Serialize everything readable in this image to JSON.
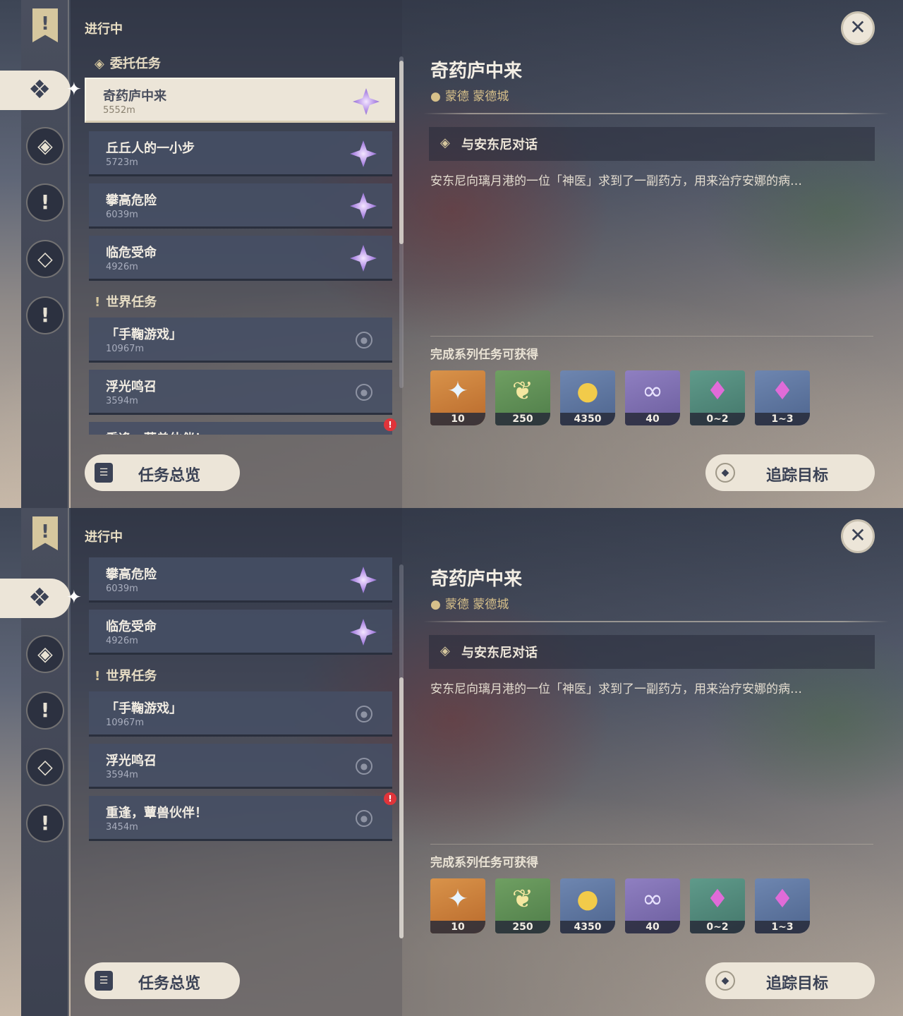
{
  "screens": [
    {
      "section_header": "进行中",
      "categories": [
        {
          "label": "委托任务"
        },
        {
          "label": "世界任务"
        }
      ],
      "quests": [
        {
          "name": "奇药庐中来",
          "distance": "5552m"
        },
        {
          "name": "丘丘人的一小步",
          "distance": "5723m"
        },
        {
          "name": "攀高危险",
          "distance": "6039m"
        },
        {
          "name": "临危受命",
          "distance": "4926m"
        },
        {
          "name": "「手鞠游戏」",
          "distance": "10967m"
        },
        {
          "name": "浮光鸣召",
          "distance": "3594m"
        },
        {
          "name": "重逢，蕈兽伙伴！",
          "distance": ""
        }
      ],
      "alert_glyph": "!",
      "buttons": {
        "overview": "任务总览",
        "track": "追踪目标"
      }
    },
    {
      "section_header": "进行中",
      "categories": [
        {
          "label": "世界任务"
        }
      ],
      "quests": [
        {
          "name": "攀高危险",
          "distance": "6039m"
        },
        {
          "name": "临危受命",
          "distance": "4926m"
        },
        {
          "name": "「手鞠游戏」",
          "distance": "10967m"
        },
        {
          "name": "浮光鸣召",
          "distance": "3594m"
        },
        {
          "name": "重逢，蕈兽伙伴！",
          "distance": "3454m"
        }
      ],
      "alert_glyph": "!",
      "buttons": {
        "overview": "任务总览",
        "track": "追踪目标"
      }
    }
  ],
  "detail": {
    "title": "奇药庐中来",
    "location": "蒙德 蒙德城",
    "objective": "与安东尼对话",
    "description": "安东尼向璃月港的一位「神医」求到了一副药方，用来治疗安娜的病…",
    "rewards_label": "完成系列任务可获得",
    "rewards": [
      {
        "icon": "primogem-icon",
        "value": "10",
        "color": "#c27a35"
      },
      {
        "icon": "adventure-exp-icon",
        "value": "250",
        "color": "#5f8f55"
      },
      {
        "icon": "mora-icon",
        "value": "4350",
        "color": "#5c74a0"
      },
      {
        "icon": "companionship-exp-icon",
        "value": "40",
        "color": "#7b6cb0"
      },
      {
        "icon": "crystal-icon",
        "value": "0~2",
        "color": "#4f8678"
      },
      {
        "icon": "crystal-cluster-icon",
        "value": "1~3",
        "color": "#5c74a0"
      }
    ]
  }
}
